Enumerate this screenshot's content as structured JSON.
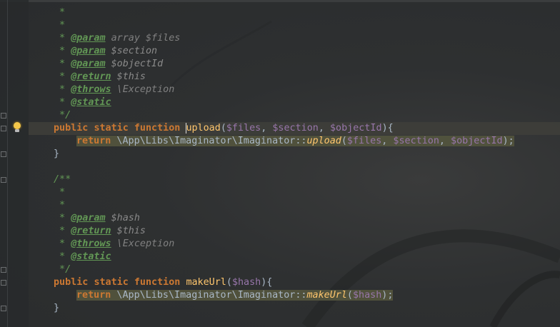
{
  "editor": {
    "colors": {
      "background": "#2b2d2e",
      "keyword": "#cc7832",
      "function": "#ffc66d",
      "variable": "#9876aa",
      "doc_tag": "#629755",
      "text": "#a9b7c6",
      "highlight": "#52533d"
    },
    "gutter_icon": "lightbulb-icon",
    "block1": {
      "doc_star1": " *",
      "doc_star2": " *",
      "param1_prefix": " * ",
      "param1_tag": "@param",
      "param1_rest": " array $files",
      "param2_prefix": " * ",
      "param2_tag": "@param",
      "param2_rest": " $section",
      "param3_prefix": " * ",
      "param3_tag": "@param",
      "param3_rest": " $objectId",
      "return_prefix": " * ",
      "return_tag": "@return",
      "return_rest": " $this",
      "throws_prefix": " * ",
      "throws_tag": "@throws",
      "throws_rest": " \\Exception",
      "static_prefix": " * ",
      "static_tag": "@static",
      "doc_close": " */",
      "sig_public": "public",
      "sig_static": "static",
      "sig_function": "function",
      "sig_name": "upload",
      "sig_open": "(",
      "sig_arg1": "$files",
      "sig_sep1": ", ",
      "sig_arg2": "$section",
      "sig_sep2": ", ",
      "sig_arg3": "$objectId",
      "sig_close": "){",
      "ret_kw": "return",
      "ret_ns": " \\App\\Libs\\Imaginator\\Imaginator::",
      "ret_call": "upload",
      "ret_open": "(",
      "ret_arg1": "$files",
      "ret_sep1": ", ",
      "ret_arg2": "$section",
      "ret_sep2": ", ",
      "ret_arg3": "$objectId",
      "ret_close": ");",
      "brace_close": "}"
    },
    "block2": {
      "doc_open": "/**",
      "doc_star1": " *",
      "doc_star2": " *",
      "param1_prefix": " * ",
      "param1_tag": "@param",
      "param1_rest": " $hash",
      "return_prefix": " * ",
      "return_tag": "@return",
      "return_rest": " $this",
      "throws_prefix": " * ",
      "throws_tag": "@throws",
      "throws_rest": " \\Exception",
      "static_prefix": " * ",
      "static_tag": "@static",
      "doc_close": " */",
      "sig_public": "public",
      "sig_static": "static",
      "sig_function": "function",
      "sig_name": "makeUrl",
      "sig_open": "(",
      "sig_arg1": "$hash",
      "sig_close": "){",
      "ret_kw": "return",
      "ret_ns": " \\App\\Libs\\Imaginator\\Imaginator::",
      "ret_call": "makeUrl",
      "ret_open": "(",
      "ret_arg1": "$hash",
      "ret_close": ");",
      "brace_close": "}"
    }
  }
}
